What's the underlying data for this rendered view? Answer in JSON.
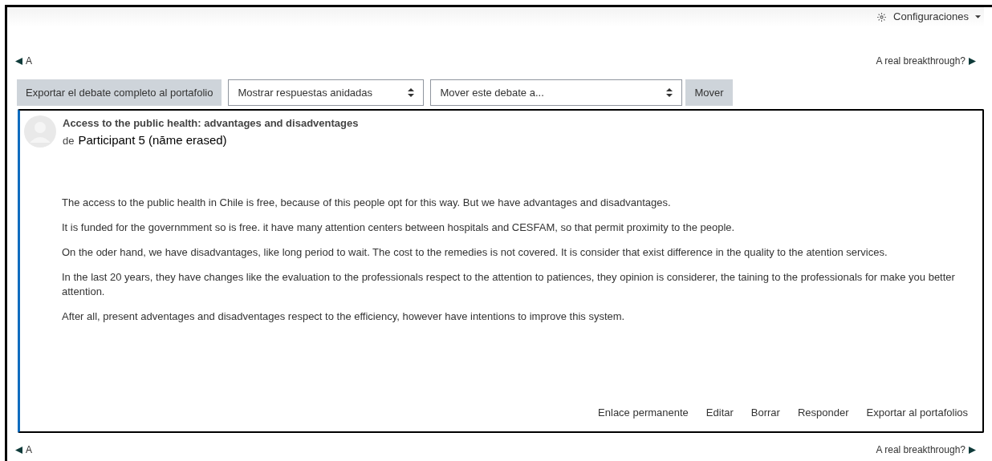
{
  "settings_menu": {
    "label": "Configuraciones"
  },
  "nav_top": {
    "prev": "A",
    "next": "A real breakthrough?"
  },
  "toolbar": {
    "export_button": "Exportar el debate completo al portafolio",
    "display_select": "Mostrar respuestas anidadas",
    "move_select": "Mover este debate a...",
    "move_button": "Mover"
  },
  "post": {
    "title": "Access to the public health: advantages and disadventages",
    "by": "de",
    "author": "Participant 5 (nāme erased)",
    "paragraphs": [
      "The access to the public health in Chile is free, because of this people opt for this way. But we have advantages and disadvantages.",
      "It is funded for the governmment so is free. it have many attention centers between hospitals and CESFAM, so that permit proximity to the people.",
      "On the oder hand, we have disadvantages, like long period to wait.  The cost to the remedies is not covered. It is consider that exist difference in the quality to the atention services.",
      "In the last 20 years, they have changes like the evaluation to the professionals respect to the attention to patiences, they opinion is considerer, the taining to the professionals for make you better attention.",
      "After all, present adventages and disadventages respect to the efficiency, however have intentions to improve this system."
    ],
    "actions": [
      "Enlace permanente",
      "Editar",
      "Borrar",
      "Responder",
      "Exportar al portafolios"
    ]
  },
  "nav_bottom": {
    "prev": "A",
    "next": "A real breakthrough?"
  }
}
